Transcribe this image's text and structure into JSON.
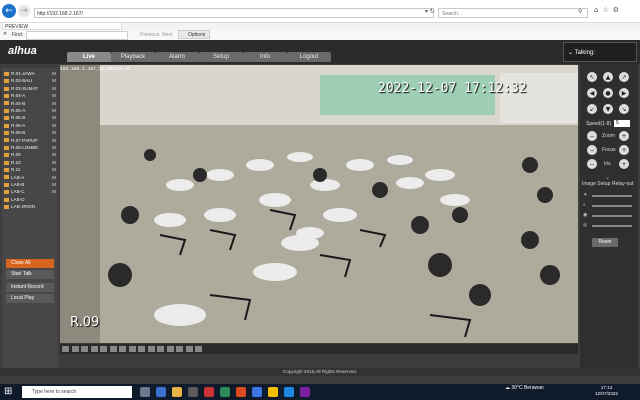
{
  "browser": {
    "url": "http://192.168.2.167/",
    "search_placeholder": "Search...",
    "tab_title": "PREVIEW",
    "find_label": "Find:",
    "find_prev": "Previous",
    "find_next": "Next",
    "find_options": "Options"
  },
  "app": {
    "logo": "alhua",
    "tabs": [
      "Live",
      "Playback",
      "Alarm",
      "Setup",
      "Info",
      "Logout"
    ],
    "talking": "Talking:",
    "cameras": [
      {
        "label": "R.01-JAWA",
        "mark": "M"
      },
      {
        "label": "R.02-BALI",
        "mark": "M"
      },
      {
        "label": "R.03-SUMAT",
        "mark": "M"
      },
      {
        "label": "R.04-A",
        "mark": "M"
      },
      {
        "label": "R.04-B",
        "mark": "M"
      },
      {
        "label": "R.05-A",
        "mark": "M"
      },
      {
        "label": "R.05-B",
        "mark": "M"
      },
      {
        "label": "R.06-A",
        "mark": "M"
      },
      {
        "label": "R.06-B",
        "mark": "M"
      },
      {
        "label": "R.07-PAPUP",
        "mark": "M"
      },
      {
        "label": "R.08-LOMBK",
        "mark": "M"
      },
      {
        "label": "R.09",
        "mark": "M"
      },
      {
        "label": "R.10",
        "mark": "M"
      },
      {
        "label": "R.11",
        "mark": "M"
      },
      {
        "label": "LAB-A",
        "mark": "M"
      },
      {
        "label": "LAB-B",
        "mark": "M"
      },
      {
        "label": "LAB-C",
        "mark": "M"
      },
      {
        "label": "LAB-D",
        "mark": ""
      },
      {
        "label": "LAB-JROIN",
        "mark": ""
      }
    ],
    "buttons": {
      "close_all": "Close All",
      "start_talk": "Start Talk",
      "instant_record": "Instant Record",
      "local_play": "Local Play"
    },
    "video": {
      "stream_info": "192.168.2.167_12_90kbps_M",
      "timestamp": "2022-12-07 17:12:32",
      "room_label": "R.09"
    },
    "ptz": {
      "speed_label": "Speed(1-8)",
      "speed_value": "5",
      "zoom_label": "Zoom",
      "focus_label": "Focus",
      "iris_label": "Iris",
      "image_setup": "Image Setup",
      "relay_out": "Relay-out",
      "reset": "Reset"
    },
    "copyright": "Copyright 2015,All Rights Reserved."
  },
  "taskbar": {
    "search_placeholder": "Type here to search",
    "weather_temp": "30°C",
    "weather_text": "Berawan",
    "time": "17:13",
    "date": "12/07/2022"
  },
  "colors": {
    "accent_orange": "#d8651f",
    "browser_blue": "#1a73c8",
    "taskbar": "#0f1a2b"
  }
}
